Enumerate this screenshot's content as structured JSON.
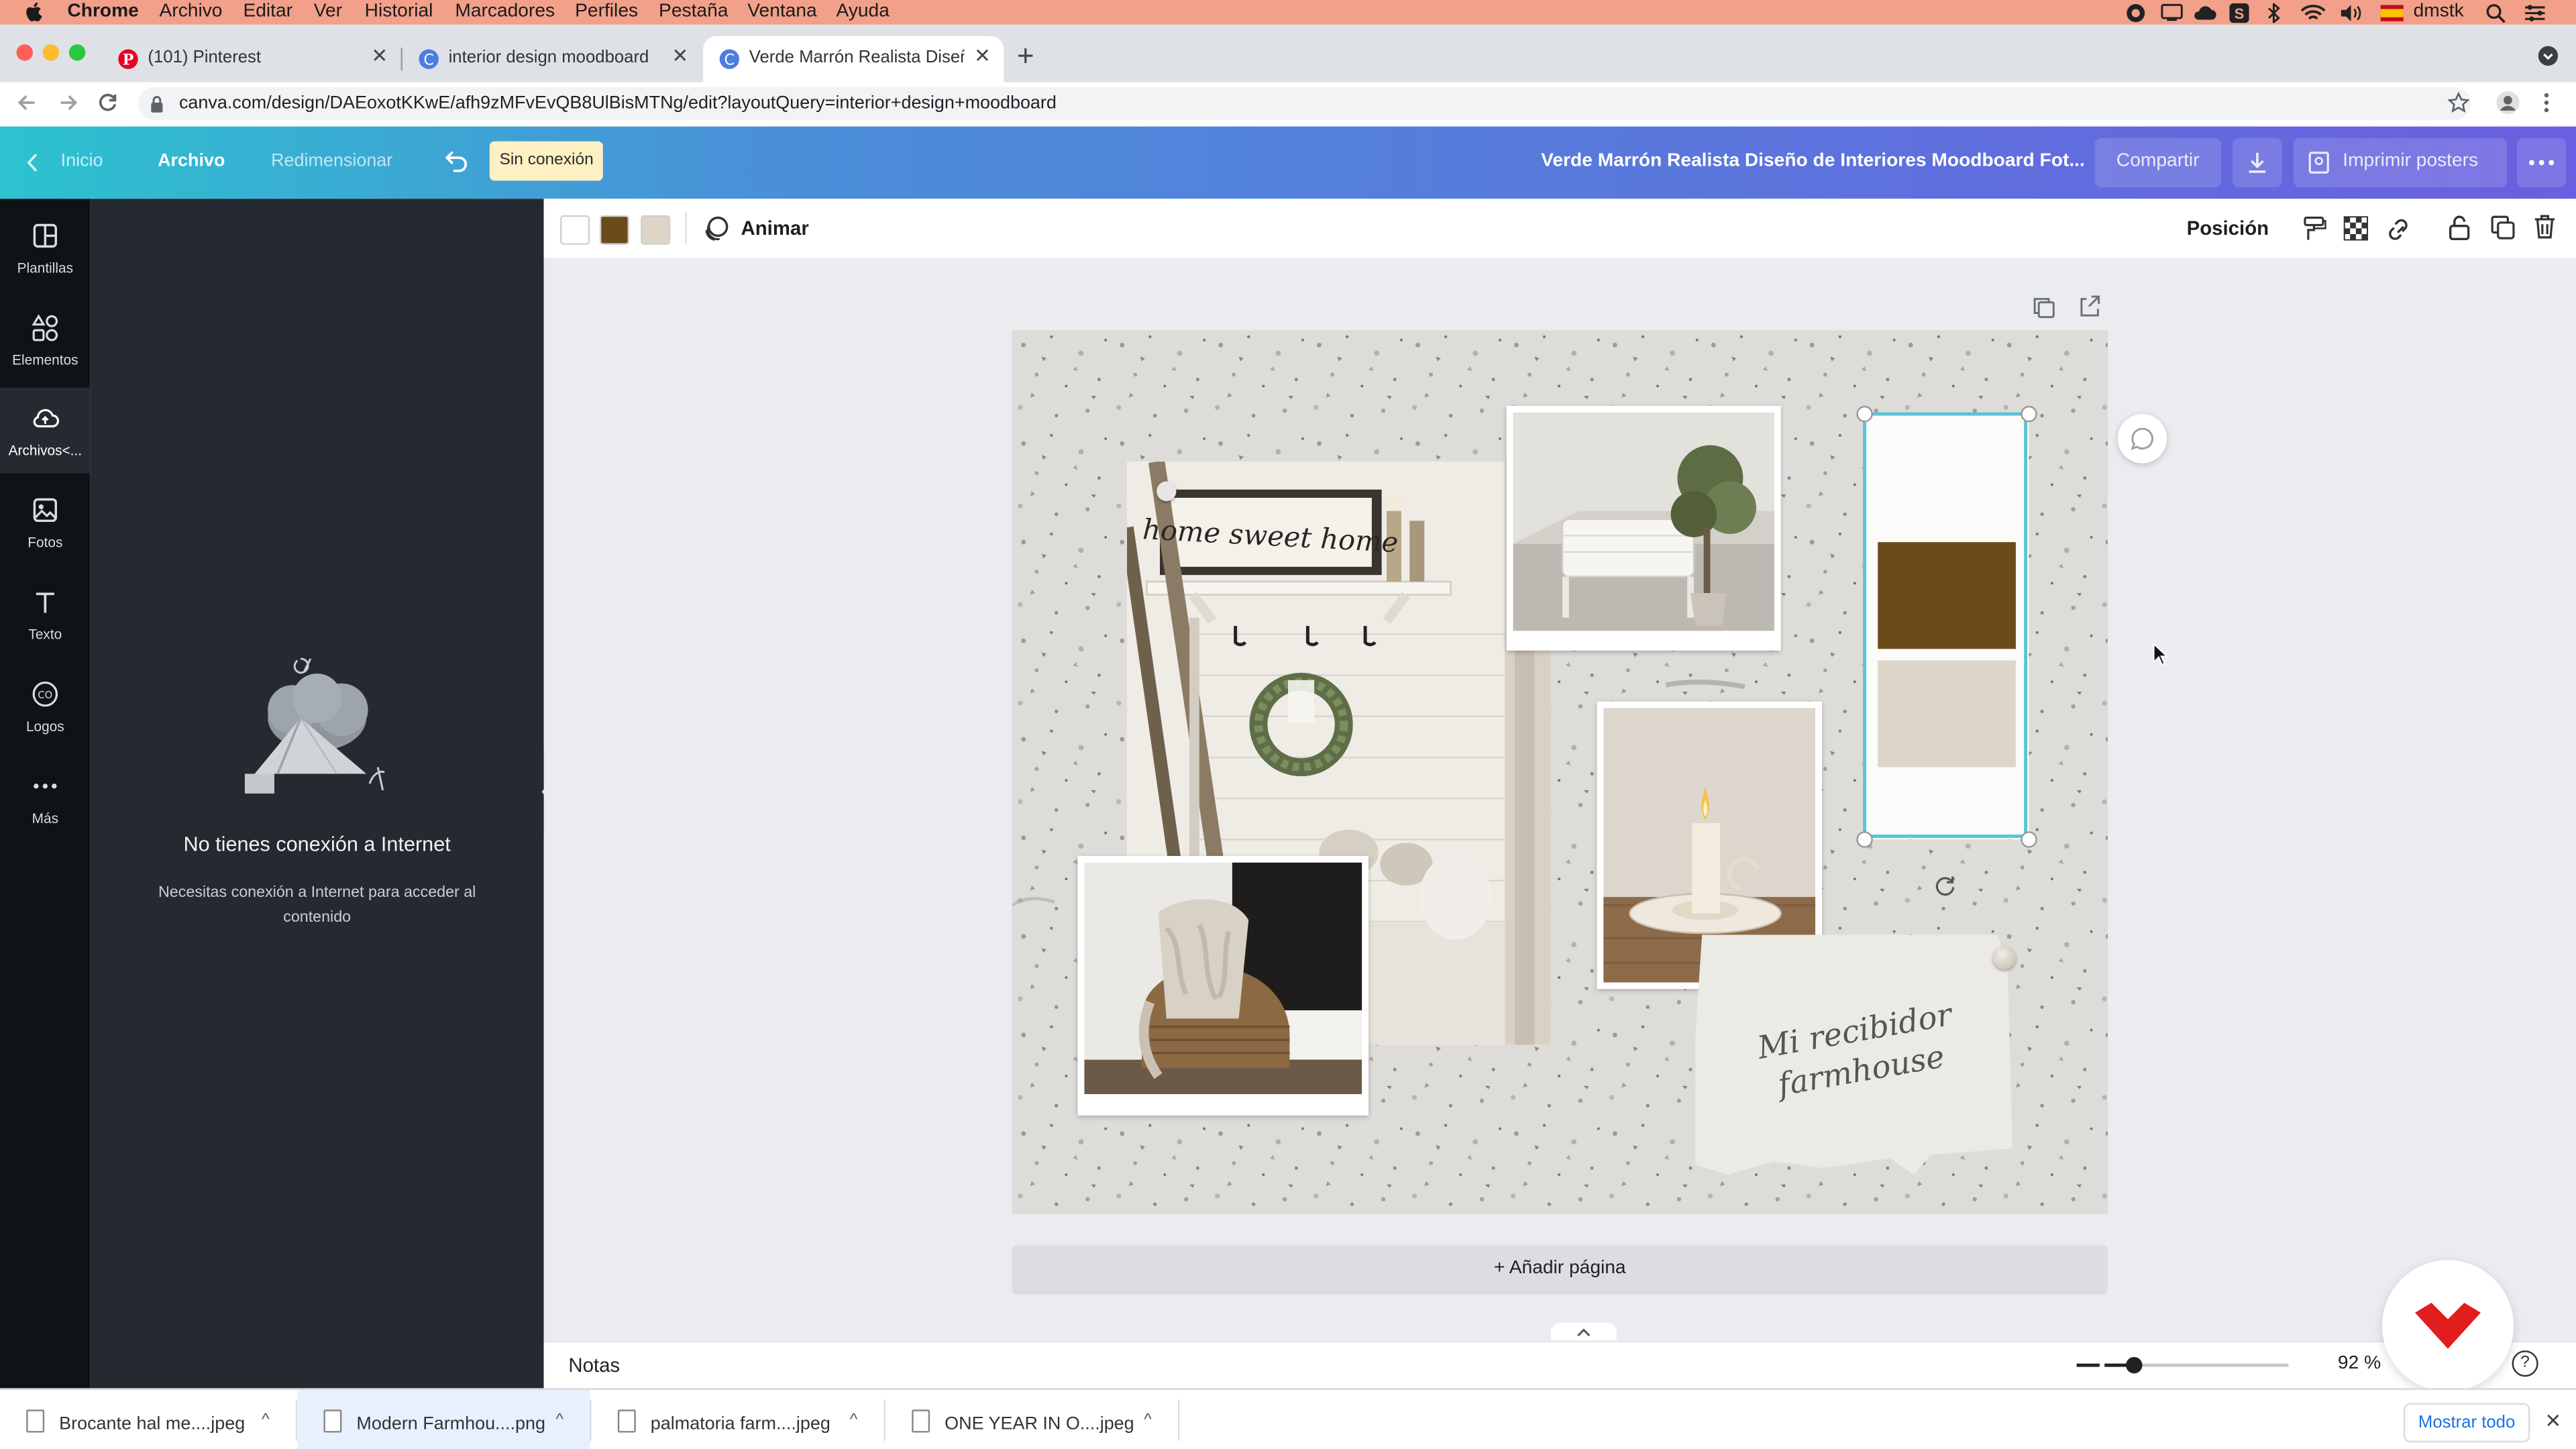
{
  "menubar": {
    "app": "Chrome",
    "items": [
      "Archivo",
      "Editar",
      "Ver",
      "Historial",
      "Marcadores",
      "Perfiles",
      "Pestaña",
      "Ventana",
      "Ayuda"
    ],
    "user": "dmstk"
  },
  "tabs": [
    {
      "title": "(101) Pinterest"
    },
    {
      "title": "interior design moodboard"
    },
    {
      "title": "Verde Marrón Realista Diseño d"
    }
  ],
  "address": {
    "url": "canva.com/design/DAEoxotKKwE/afh9zMFvEvQB8UlBisMTNg/edit?layoutQuery=interior+design+moodboard"
  },
  "canva_header": {
    "home": "Inicio",
    "file": "Archivo",
    "resize": "Redimensionar",
    "offline_badge": "Sin conexión",
    "doc_title": "Verde Marrón Realista Diseño de Interiores Moodboard Fot...",
    "share": "Compartir",
    "print": "Imprimir posters"
  },
  "sidebar": {
    "items": [
      {
        "label": "Plantillas",
        "icon": "templates-icon"
      },
      {
        "label": "Elementos",
        "icon": "elements-icon"
      },
      {
        "label": "Archivos<...",
        "icon": "upload-cloud-icon"
      },
      {
        "label": "Fotos",
        "icon": "photos-icon"
      },
      {
        "label": "Texto",
        "icon": "text-icon"
      },
      {
        "label": "Logos",
        "icon": "logos-icon"
      },
      {
        "label": "Más",
        "icon": "more-icon"
      }
    ],
    "active_index": 2
  },
  "panel": {
    "title": "No tienes conexión a Internet",
    "subtitle": "Necesitas conexión a Internet para acceder al contenido"
  },
  "toolbar": {
    "swatches": [
      "#ffffff",
      "#6b4a1c",
      "#ddd5c8"
    ],
    "animate": "Animar",
    "position": "Posición"
  },
  "canvas": {
    "note_text_line1": "Mi recibidor",
    "note_text_line2": "farmhouse",
    "sign_text": "home sweet home",
    "palette": [
      "#fbfbf9",
      "#6b4a1c",
      "#ddd5c8"
    ],
    "add_page": "+ Añadir página"
  },
  "footer": {
    "notes": "Notas",
    "zoom": "92 %",
    "zoom_level": 0.16
  },
  "downloads": {
    "files": [
      {
        "name": "Brocante hal me....jpeg"
      },
      {
        "name": "Modern Farmhou....png"
      },
      {
        "name": "palmatoria farm....jpeg"
      },
      {
        "name": "ONE YEAR IN O....jpeg"
      }
    ],
    "show_all": "Mostrar todo"
  }
}
